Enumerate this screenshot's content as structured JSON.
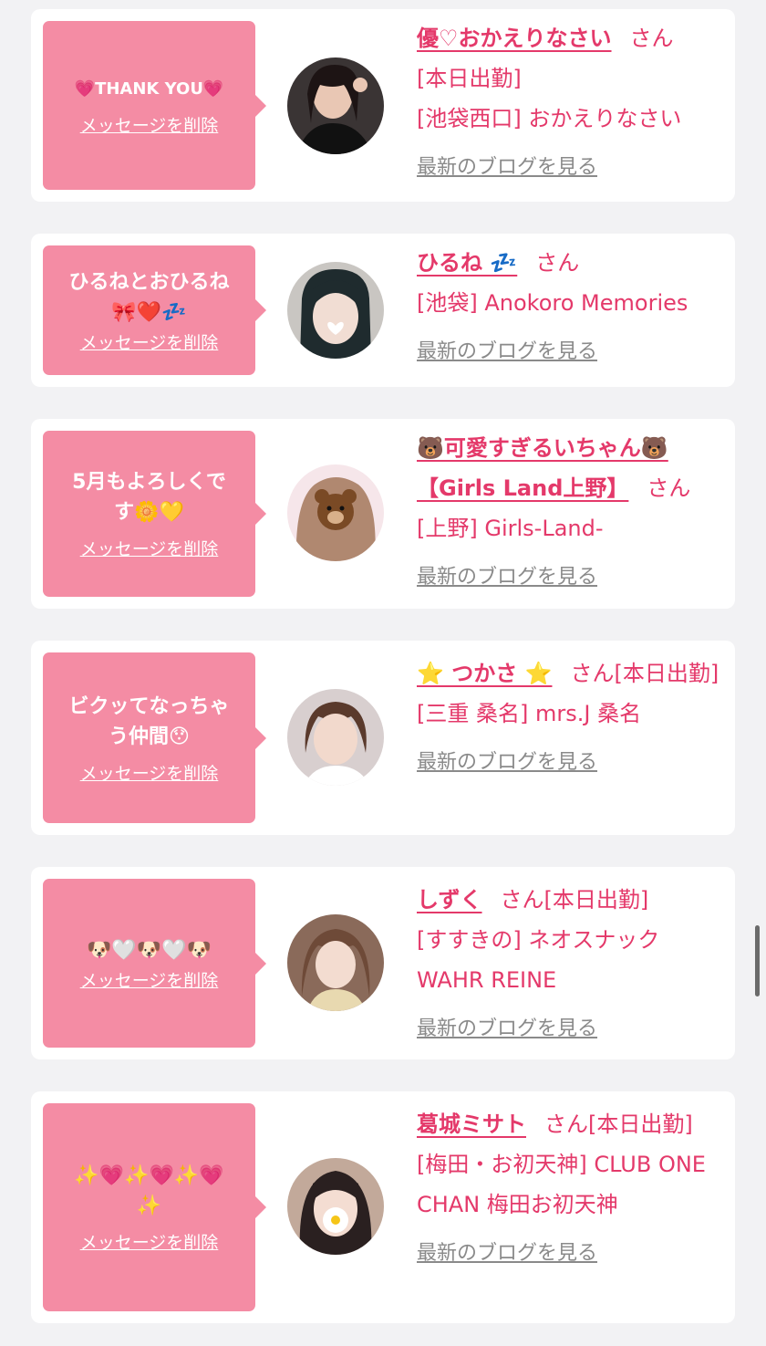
{
  "colors": {
    "accent": "#e4396a",
    "bubble": "#f48ca4",
    "link_gray": "#8a8a8a",
    "background": "#f2f2f4"
  },
  "cards": [
    {
      "message": "💗THANK YOU💗",
      "delete_label": "メッセージを削除",
      "name": "優♡おかえりなさい",
      "honorific": "さん",
      "lines": [
        "[本日出勤]",
        "[池袋西口] おかえりなさい"
      ],
      "blog_label": "最新のブログを見る",
      "avatar_icon": "woman-portrait-avatar"
    },
    {
      "message": "ひるねとおひるね\n🎀❤️💤",
      "delete_label": "メッセージを削除",
      "name": "ひるね 💤",
      "honorific": "さん",
      "lines": [
        "[池袋] Anokoro Memories"
      ],
      "blog_label": "最新のブログを見る",
      "avatar_icon": "girl-heart-sticker-avatar"
    },
    {
      "message": "5月もよろしくで\nす🌼💛",
      "delete_label": "メッセージを削除",
      "name": "🐻可愛すぎるいちゃん🐻【Girls Land上野】",
      "honorific": "さん",
      "lines": [
        "[上野] Girls-Land-"
      ],
      "blog_label": "最新のブログを見る",
      "avatar_icon": "bear-sticker-avatar"
    },
    {
      "message": "ビクッてなっちゃ\nう仲間😯",
      "delete_label": "メッセージを削除",
      "name": "⭐️ つかさ ⭐️",
      "honorific": "さん[本日出勤]",
      "lines": [
        "[三重 桑名] mrs.J 桑名"
      ],
      "blog_label": "最新のブログを見る",
      "avatar_icon": "short-hair-avatar"
    },
    {
      "message": "🐶🤍🐶🤍🐶",
      "delete_label": "メッセージを削除",
      "name": "しずく",
      "honorific": "さん[本日出勤]",
      "lines": [
        "[すすきの] ネオスナック WAHR REINE"
      ],
      "blog_label": "最新のブログを見る",
      "avatar_icon": "bangs-girl-avatar"
    },
    {
      "message": "✨💗✨💗✨💗\n✨",
      "delete_label": "メッセージを削除",
      "name": "葛城ミサト",
      "honorific": "さん[本日出勤]",
      "lines": [
        "[梅田・お初天神] CLUB ONE CHAN 梅田お初天神"
      ],
      "blog_label": "最新のブログを見る",
      "avatar_icon": "flower-sticker-avatar"
    }
  ]
}
